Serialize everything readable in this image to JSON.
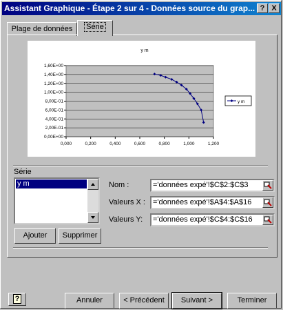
{
  "window": {
    "title": "Assistant Graphique - Étape 2 sur 4 - Données source du grap...",
    "help_button": "?",
    "close_button": "X"
  },
  "tabs": [
    {
      "label": "Plage de données",
      "active": false
    },
    {
      "label": "Série",
      "active": true
    }
  ],
  "chart_data": {
    "type": "scatter",
    "title": "y m",
    "xlabel": "",
    "ylabel": "",
    "xlim": [
      0,
      1.2
    ],
    "ylim": [
      0,
      1.6
    ],
    "x_ticks": [
      "0,000",
      "0,200",
      "0,400",
      "0,600",
      "0,800",
      "1,000",
      "1,200"
    ],
    "y_ticks": [
      "0,00E+00",
      "2,00E-01",
      "4,00E-01",
      "6,00E-01",
      "8,00E-01",
      "1,00E+00",
      "1,20E+00",
      "1,40E+00",
      "1,60E+00"
    ],
    "series": [
      {
        "name": "y m",
        "color": "#000080",
        "x": [
          0.72,
          0.77,
          0.81,
          0.86,
          0.9,
          0.94,
          0.98,
          1.01,
          1.04,
          1.07,
          1.1,
          1.12
        ],
        "y": [
          1.41,
          1.38,
          1.34,
          1.29,
          1.23,
          1.16,
          1.07,
          0.97,
          0.86,
          0.74,
          0.6,
          0.32
        ]
      }
    ],
    "legend": {
      "label": "y m",
      "position": "right"
    },
    "grid": true
  },
  "serie_section": {
    "label": "Série",
    "list_items": [
      "y m"
    ],
    "selected_item": "y m"
  },
  "fields": {
    "nom_label": "Nom :",
    "nom_value": "='données expé'!$C$2:$C$3",
    "x_label": "Valeurs X :",
    "x_value": "='données expé'!$A$4:$A$16",
    "y_label": "Valeurs Y:",
    "y_value": "='données expé'!$C$4:$C$16"
  },
  "buttons": {
    "add": "Ajouter",
    "delete": "Supprimer",
    "help_icon": "?",
    "cancel": "Annuler",
    "previous": "< Précédent",
    "next": "Suivant >",
    "finish": "Terminer"
  }
}
